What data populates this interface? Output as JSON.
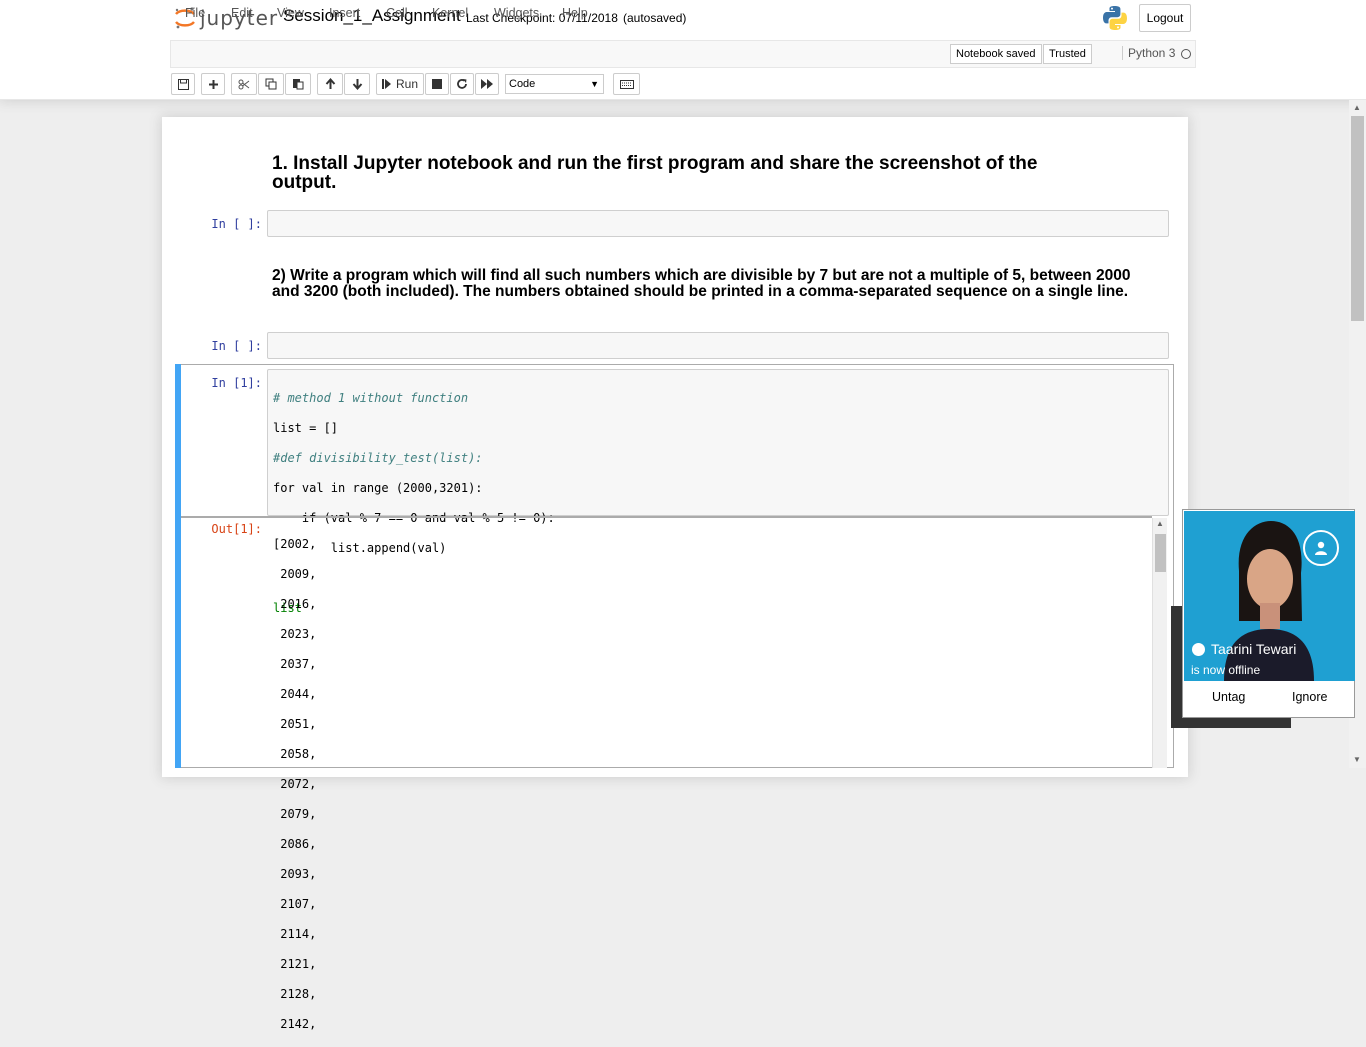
{
  "header": {
    "logo_text": "jupyter",
    "notebook_name": "Session_1_Assignment",
    "checkpoint": "Last Checkpoint: 07/11/2018",
    "autosaved": "(autosaved)",
    "logout": "Logout"
  },
  "menu": {
    "items": [
      "File",
      "Edit",
      "View",
      "Insert",
      "Cell",
      "Kernel",
      "Widgets",
      "Help"
    ],
    "notebook_saved": "Notebook saved",
    "trusted": "Trusted",
    "kernel": "Python 3"
  },
  "toolbar": {
    "run_label": "Run",
    "cell_type": "Code",
    "icons": [
      "save-icon",
      "plus-icon",
      "cut-icon",
      "copy-icon",
      "paste-icon",
      "arrow-up-icon",
      "arrow-down-icon",
      "run-icon",
      "stop-icon",
      "restart-icon",
      "fast-forward-icon",
      "keyboard-icon"
    ]
  },
  "cells": {
    "md1": "1. Install Jupyter notebook and run the first program and share the screenshot of the output.",
    "prompt1": "In [ ]:",
    "md2": "2) Write a program which will find all such numbers which are divisible by 7 but are not a multiple of 5, between 2000 and 3200 (both included). The numbers obtained should be printed in a comma-separated sequence on a single line.",
    "prompt2": "In [ ]:",
    "prompt3": "In [1]:",
    "out_prompt": "Out[1]:",
    "code_lines": [
      "# method 1 without function",
      "list = []",
      "#def divisibility_test(list):",
      "for val in range (2000,3201):",
      "    if (val % 7 == 0 and val % 5 != 0):",
      "        list.append(val)",
      "",
      "list"
    ],
    "output_lines": [
      "[2002,",
      " 2009,",
      " 2016,",
      " 2023,",
      " 2037,",
      " 2044,",
      " 2051,",
      " 2058,",
      " 2072,",
      " 2079,",
      " 2086,",
      " 2093,",
      " 2107,",
      " 2114,",
      " 2121,",
      " 2128,",
      " 2142,"
    ]
  },
  "notification": {
    "name": "Taarini Tewari",
    "status": "is now offline",
    "untag": "Untag",
    "ignore": "Ignore"
  },
  "colors": {
    "selected_cell_bar": "#42a5f5",
    "in_prompt": "#303f9f",
    "out_prompt": "#d84315",
    "toast_bg": "#1fa0d2"
  }
}
